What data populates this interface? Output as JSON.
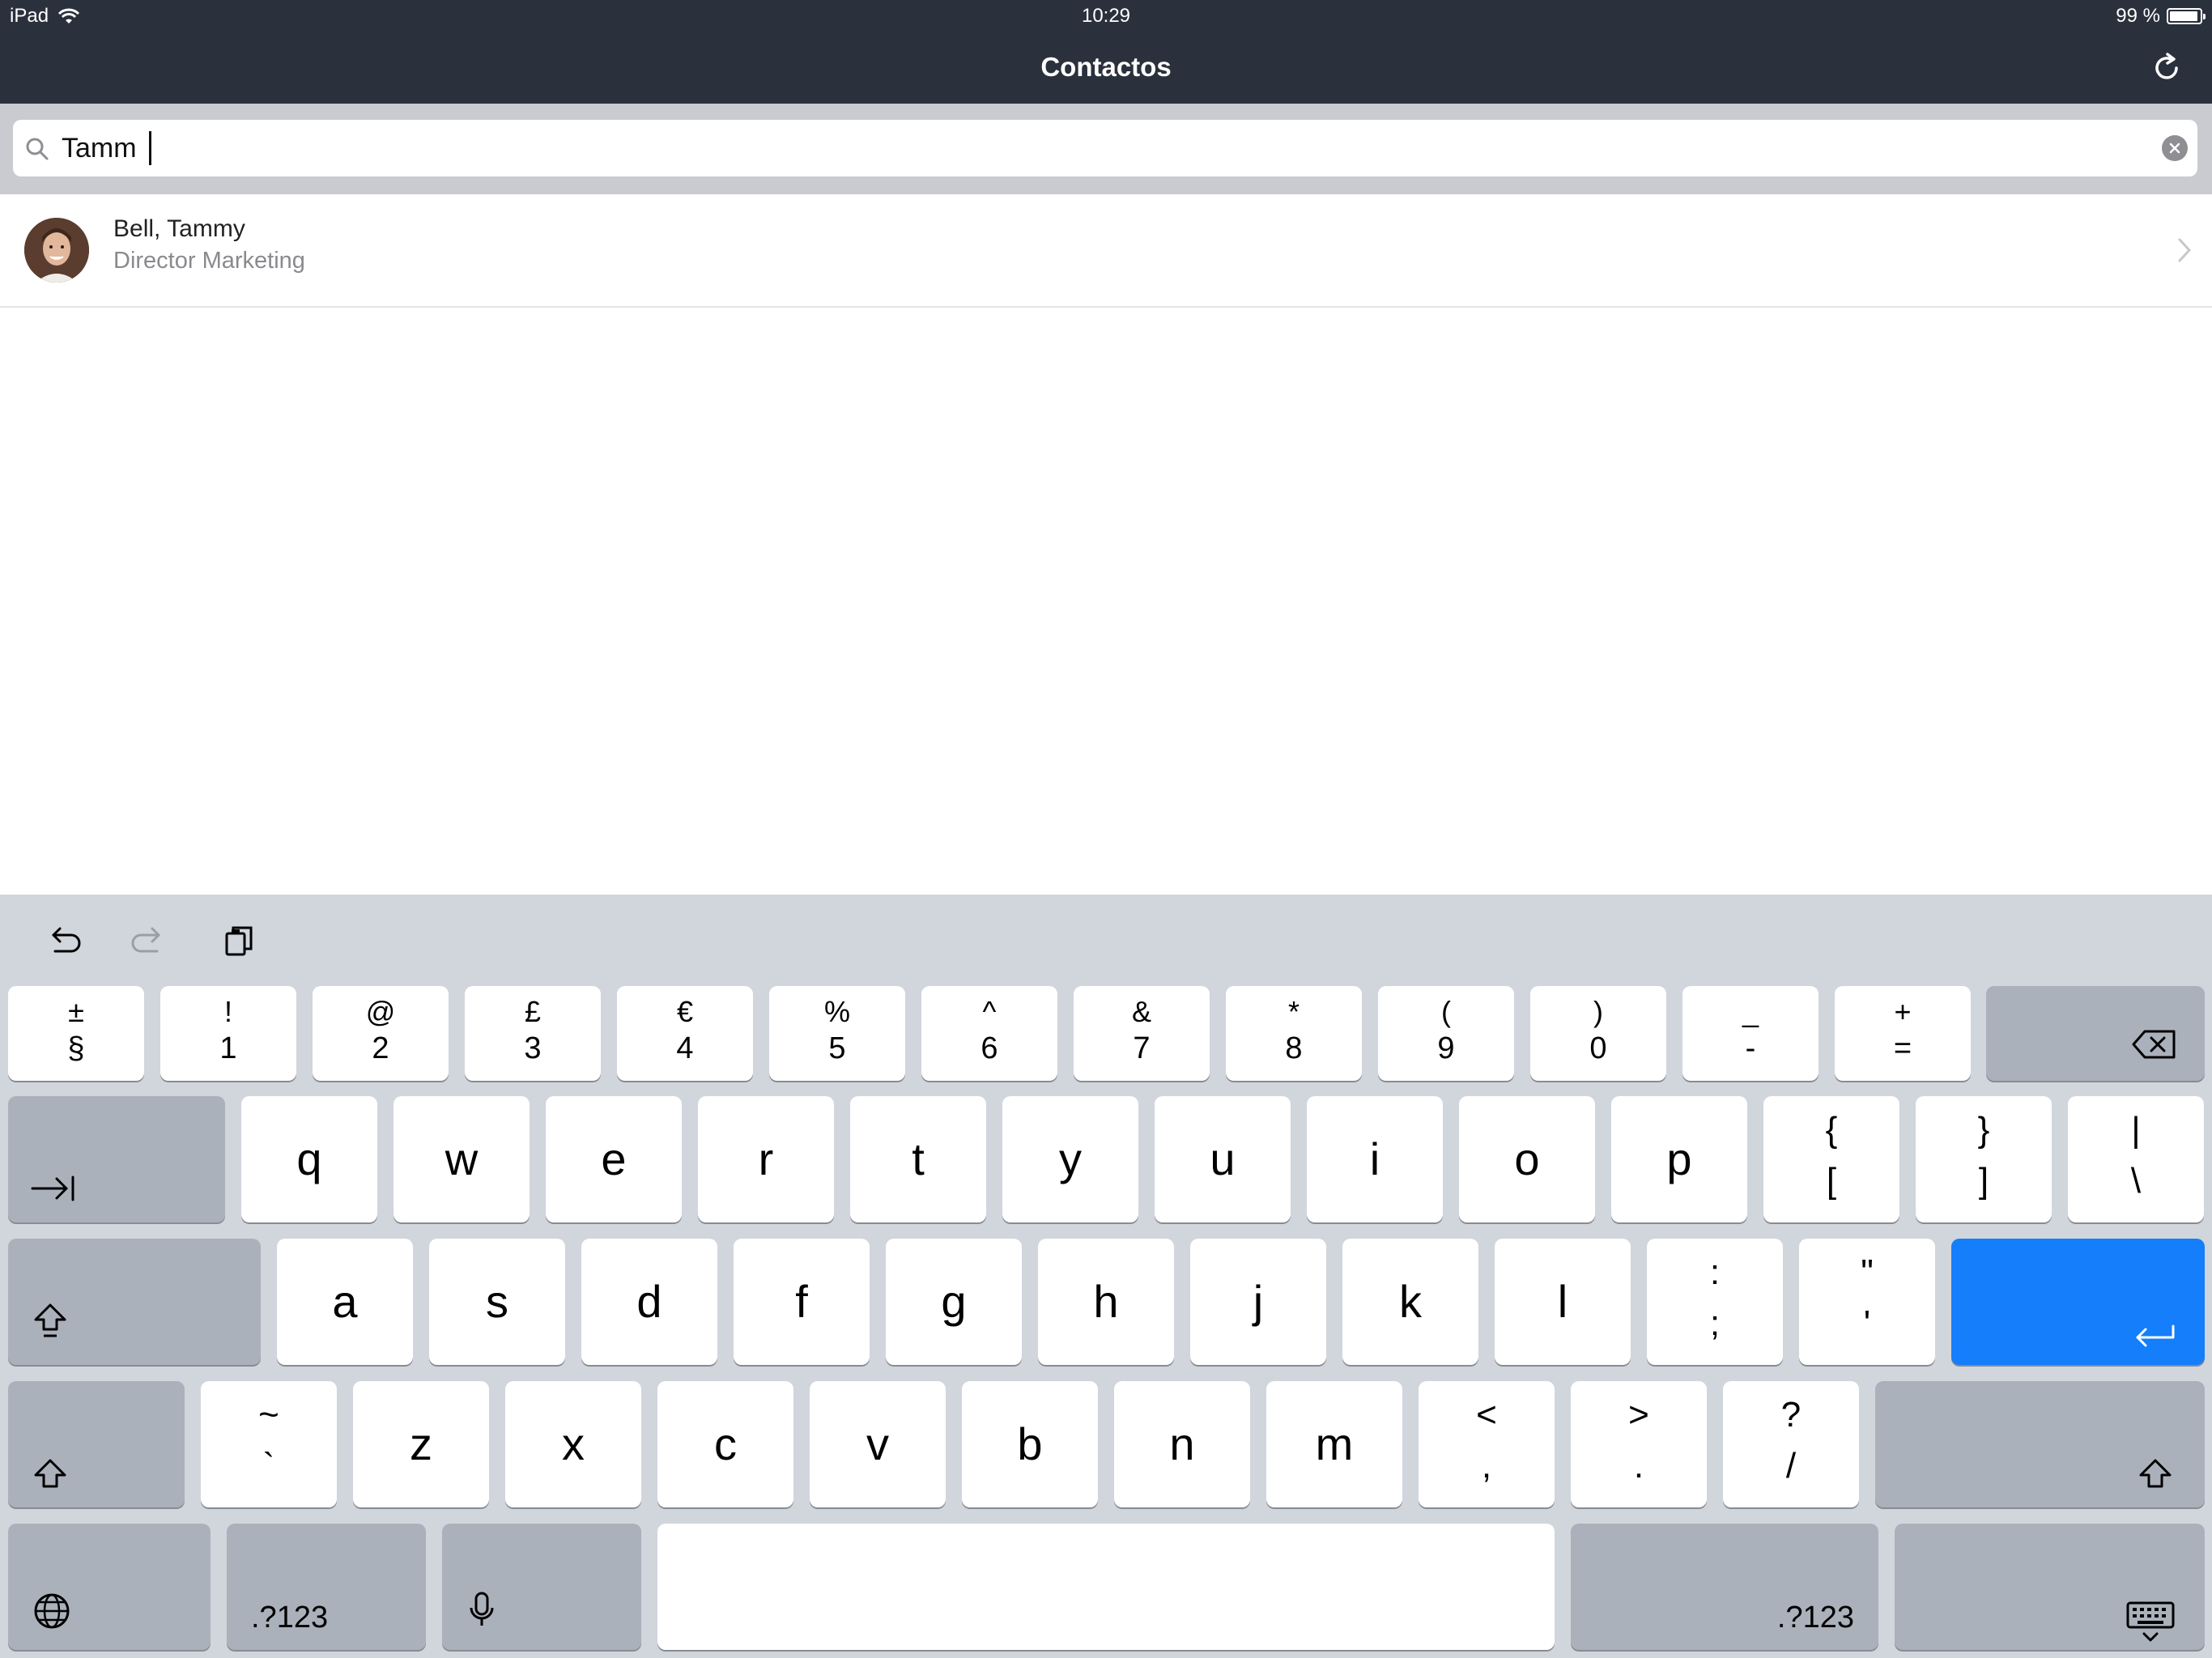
{
  "status_bar": {
    "device": "iPad",
    "time": "10:29",
    "battery": "99 %",
    "battery_level": 0.99
  },
  "nav": {
    "title": "Contactos",
    "refresh_icon": "refresh-icon"
  },
  "search": {
    "value": "Tamm",
    "search_icon": "search-icon",
    "clear_icon": "clear-icon"
  },
  "contacts": [
    {
      "name": "Bell, Tammy",
      "title": "Director Marketing"
    }
  ],
  "keyboard": {
    "toolbar": [
      "undo-icon",
      "redo-icon",
      "paste-icon"
    ],
    "row_numbers": [
      {
        "top": "±",
        "bottom": "§"
      },
      {
        "top": "!",
        "bottom": "1"
      },
      {
        "top": "@",
        "bottom": "2"
      },
      {
        "top": "£",
        "bottom": "3"
      },
      {
        "top": "€",
        "bottom": "4"
      },
      {
        "top": "%",
        "bottom": "5"
      },
      {
        "top": "^",
        "bottom": "6"
      },
      {
        "top": "&",
        "bottom": "7"
      },
      {
        "top": "*",
        "bottom": "8"
      },
      {
        "top": "(",
        "bottom": "9"
      },
      {
        "top": ")",
        "bottom": "0"
      },
      {
        "top": "_",
        "bottom": "-"
      },
      {
        "top": "+",
        "bottom": "="
      }
    ],
    "row_q": [
      "q",
      "w",
      "e",
      "r",
      "t",
      "y",
      "u",
      "i",
      "o",
      "p"
    ],
    "row_q_symbols": [
      {
        "top": "{",
        "bottom": "["
      },
      {
        "top": "}",
        "bottom": "]"
      },
      {
        "top": "|",
        "bottom": "\\"
      }
    ],
    "row_a": [
      "a",
      "s",
      "d",
      "f",
      "g",
      "h",
      "j",
      "k",
      "l"
    ],
    "row_a_symbols": [
      {
        "top": ":",
        "bottom": ";"
      },
      {
        "top": "\"",
        "bottom": "'"
      }
    ],
    "row_z_tilde": {
      "top": "~",
      "bottom": "`"
    },
    "row_z": [
      "z",
      "x",
      "c",
      "v",
      "b",
      "n",
      "m"
    ],
    "row_z_symbols": [
      {
        "top": "<",
        "bottom": ","
      },
      {
        "top": ">",
        "bottom": "."
      },
      {
        "top": "?",
        "bottom": "/"
      }
    ],
    "numbers_label": ".?123",
    "icons": {
      "delete": "backspace-icon",
      "tab": "tab-icon",
      "return": "return-icon",
      "shift": "shift-icon",
      "caps": "caps-lock-icon",
      "globe": "globe-icon",
      "mic": "microphone-icon",
      "dismiss": "keyboard-dismiss-icon"
    },
    "accent_color": "#147efb"
  }
}
